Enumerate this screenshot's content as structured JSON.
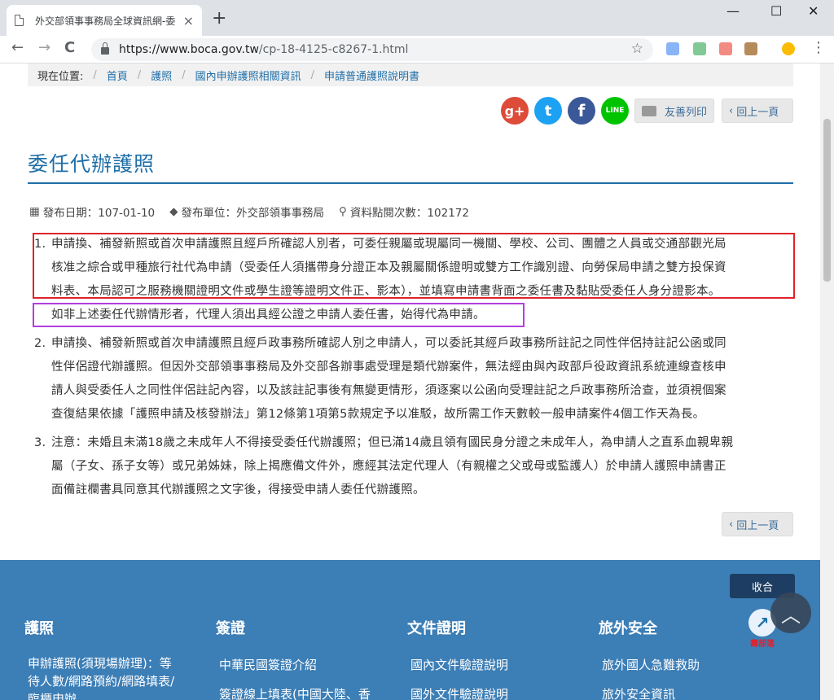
{
  "browser": {
    "tab_title": "外交部領事事務局全球資訊網-委",
    "tab_close": "×",
    "new_tab": "+",
    "url_host": "https://www.boca.gov.tw",
    "url_path": "/cp-18-4125-c8267-1.html",
    "back": "←",
    "forward": "→",
    "reload": "C",
    "star": "☆",
    "menu": "⋮",
    "minimize": "—",
    "maximize": "☐",
    "close": "✕"
  },
  "breadcrumb": {
    "label": "現在位置:",
    "items": [
      "首頁",
      "護照",
      "國內申辦護照相關資訊",
      "申請普通護照說明書"
    ]
  },
  "share": {
    "gplus": "g+",
    "twitter": "t",
    "facebook": "f",
    "line": "LINE",
    "print_label": "友善列印",
    "back_label": "回上一頁"
  },
  "page": {
    "title": "委任代辦護照",
    "meta": {
      "date_label": "發布日期：107-01-10",
      "unit_label": "發布單位：外交部領事事務局",
      "views_label": "資料點閱次數：102172"
    },
    "items": [
      {
        "num": "1.",
        "lines": [
          "申請換、補發新照或首次申請護照且經戶所確認人別者，可委任親屬或現屬同一機關、學校、公司、團體之人員或交通部觀光局",
          "核准之綜合或甲種旅行社代為申請（受委任人須攜帶身分證正本及親屬關係證明或雙方工作識別證、向勞保局申請之雙方投保資",
          "料表、本局認可之服務機關證明文件或學生證等證明文件正、影本），並填寫申請書背面之委任書及黏貼受委任人身分證影本。"
        ],
        "note": "如非上述委任代辦情形者，代理人須出具經公證之申請人委任書，始得代為申請。"
      },
      {
        "num": "2.",
        "lines": [
          "申請換、補發新照或首次申請護照且經戶政事務所確認人別之申請人，可以委託其經戶政事務所註記之同性伴侶持註記公函或同",
          "性伴侶證代辦護照。但因外交部領事事務局及外交部各辦事處受理是類代辦案件，無法經由與內政部戶役政資訊系統連線查核申",
          "請人與受委任人之同性伴侶註記內容，以及該註記事後有無變更情形，須逐案以公函向受理註記之戶政事務所洽查，並須視個案",
          "查復結果依據「護照申請及核發辦法」第12條第1項第5款規定予以准駁，故所需工作天數較一般申請案件4個工作天為長。"
        ]
      },
      {
        "num": "3.",
        "lines": [
          "注意：未婚且未滿18歲之未成年人不得接受委任代辦護照；但已滿14歲且領有國民身分證之未成年人，為申請人之直系血親卑親",
          "屬（子女、孫子女等）或兄弟姊妹，除上揭應備文件外，應經其法定代理人（有親權之父或母或監護人）於申請人護照申請書正",
          "面備註欄書具同意其代辦護照之文字後，得接受申請人委任代辦護照。"
        ]
      }
    ]
  },
  "footer": {
    "collapse_label": "收合",
    "logo_text": "壽部落",
    "to_top": "︿",
    "columns": [
      {
        "title": "護照",
        "links": [
          "申辦護照(須現場辦理)：等",
          "待人數/網路預約/網路填表/",
          "臨櫃申辦"
        ]
      },
      {
        "title": "簽證",
        "links": [
          "中華民國簽證介紹",
          "簽證線上填表(中國大陸、香"
        ]
      },
      {
        "title": "文件證明",
        "links": [
          "國內文件驗證說明",
          "國外文件驗證說明"
        ]
      },
      {
        "title": "旅外安全",
        "links": [
          "旅外國人急難救助",
          "旅外安全資訊"
        ]
      }
    ]
  },
  "colors": {
    "accent": "#1f6fa8",
    "footer_bg": "#3c7eb6",
    "highlight_red": "#e0222b",
    "highlight_purple": "#b23ee0"
  }
}
